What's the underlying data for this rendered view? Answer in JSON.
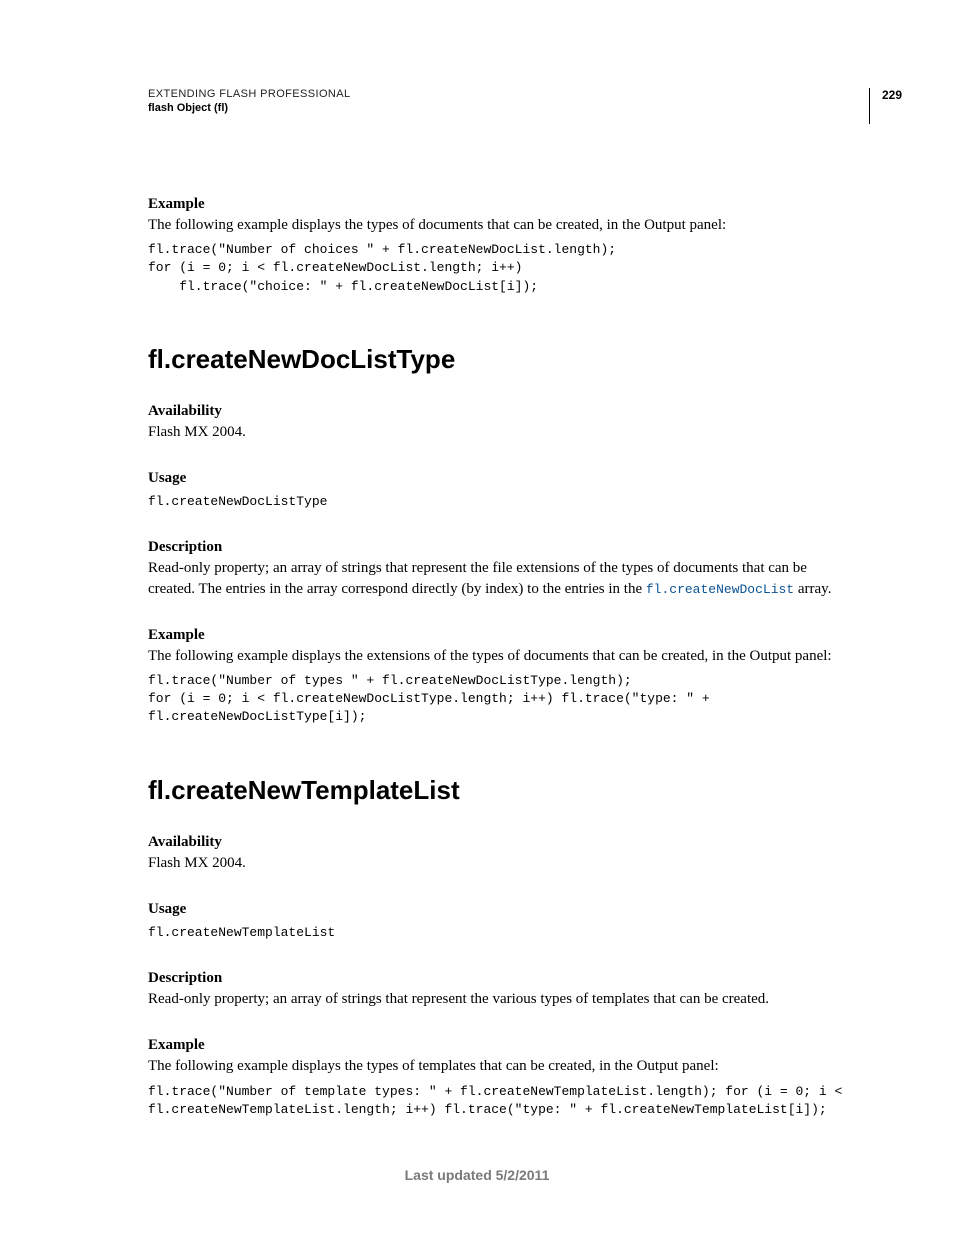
{
  "header": {
    "title": "EXTENDING FLASH PROFESSIONAL",
    "subtitle": "flash Object (fl)",
    "page_number": "229"
  },
  "section1": {
    "label_example": "Example",
    "example_intro": "The following example displays the types of documents that can be created, in the Output panel:",
    "code": "fl.trace(\"Number of choices \" + fl.createNewDocList.length);\nfor (i = 0; i < fl.createNewDocList.length; i++)\n    fl.trace(\"choice: \" + fl.createNewDocList[i]);"
  },
  "section2": {
    "heading": "fl.createNewDocListType",
    "label_availability": "Availability",
    "availability_text": "Flash MX 2004.",
    "label_usage": "Usage",
    "usage_code": "fl.createNewDocListType",
    "label_description": "Description",
    "description_text_a": "Read-only property; an array of strings that represent the file extensions of the types of documents that can be created. The entries in the array correspond directly (by index) to the entries in the ",
    "description_link": "fl.createNewDocList",
    "description_text_b": " array.",
    "label_example": "Example",
    "example_intro": "The following example displays the extensions of the types of documents that can be created, in the Output panel:",
    "code": "fl.trace(\"Number of types \" + fl.createNewDocListType.length);\nfor (i = 0; i < fl.createNewDocListType.length; i++) fl.trace(\"type: \" + \nfl.createNewDocListType[i]);"
  },
  "section3": {
    "heading": "fl.createNewTemplateList",
    "label_availability": "Availability",
    "availability_text": "Flash MX 2004.",
    "label_usage": "Usage",
    "usage_code": "fl.createNewTemplateList",
    "label_description": "Description",
    "description_text": "Read-only property; an array of strings that represent the various types of templates that can be created.",
    "label_example": "Example",
    "example_intro": "The following example displays the types of templates that can be created, in the Output panel:",
    "code": "fl.trace(\"Number of template types: \" + fl.createNewTemplateList.length); for (i = 0; i < \nfl.createNewTemplateList.length; i++) fl.trace(\"type: \" + fl.createNewTemplateList[i]);"
  },
  "footer": {
    "text": "Last updated 5/2/2011"
  }
}
